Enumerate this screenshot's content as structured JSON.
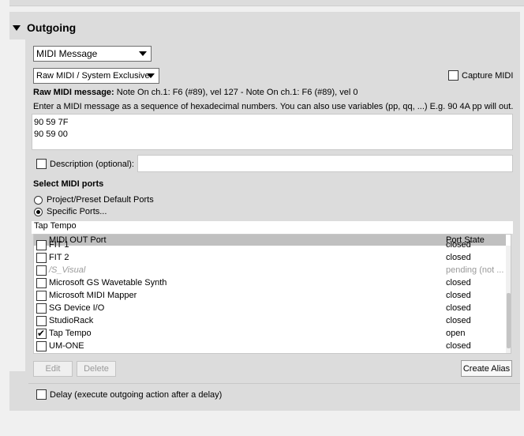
{
  "section": {
    "title": "Outgoing"
  },
  "message_type": {
    "selected": "MIDI Message"
  },
  "midi_kind": {
    "selected": "Raw MIDI / System Exclusive"
  },
  "capture": {
    "label": "Capture MIDI",
    "checked": false
  },
  "raw": {
    "label": "Raw MIDI message:",
    "value": "Note On ch.1: F6 (#89), vel 127 - Note On ch.1: F6 (#89), vel 0",
    "hint": "Enter a MIDI message as a sequence of hexadecimal numbers. You can also use variables (pp, qq, ...) E.g. 90 4A pp will out...",
    "lines": [
      "90 59 7F",
      "90 59 00"
    ]
  },
  "description": {
    "label": "Description (optional):",
    "value": ""
  },
  "ports": {
    "title": "Select MIDI ports",
    "options": [
      "Project/Preset Default Ports",
      "Specific Ports..."
    ],
    "selected_index": 1,
    "filter": "Tap Tempo",
    "columns": [
      "MIDI OUT Port",
      "Port State"
    ],
    "rows": [
      {
        "name": "FIT 1",
        "state": "closed",
        "checked": false,
        "muted": false
      },
      {
        "name": "FIT 2",
        "state": "closed",
        "checked": false,
        "muted": false
      },
      {
        "name": "/S_Visual",
        "state": "pending (not ...",
        "checked": false,
        "muted": true
      },
      {
        "name": "Microsoft GS Wavetable Synth",
        "state": "closed",
        "checked": false,
        "muted": false
      },
      {
        "name": "Microsoft MIDI Mapper",
        "state": "closed",
        "checked": false,
        "muted": false
      },
      {
        "name": "SG Device I/O",
        "state": "closed",
        "checked": false,
        "muted": false
      },
      {
        "name": "StudioRack",
        "state": "closed",
        "checked": false,
        "muted": false
      },
      {
        "name": "Tap Tempo",
        "state": "open",
        "checked": true,
        "muted": false
      },
      {
        "name": "UM-ONE",
        "state": "closed",
        "checked": false,
        "muted": false
      }
    ]
  },
  "buttons": {
    "edit": "Edit",
    "delete": "Delete",
    "create_alias": "Create Alias"
  },
  "delay": {
    "label": "Delay (execute outgoing action after a delay)",
    "checked": false
  }
}
